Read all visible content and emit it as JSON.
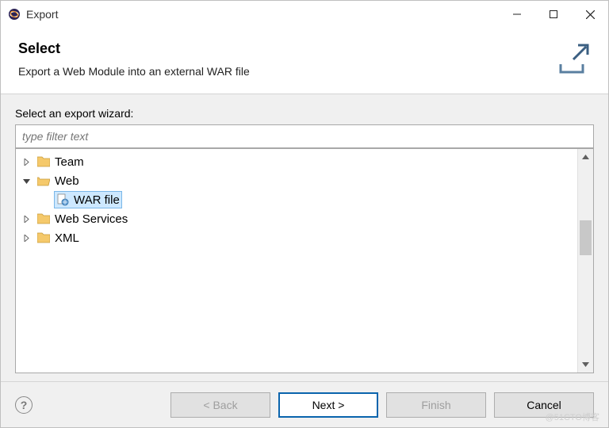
{
  "window": {
    "title": "Export"
  },
  "header": {
    "title": "Select",
    "description": "Export a Web Module into an external WAR file"
  },
  "main": {
    "wizard_label": "Select an export wizard:",
    "filter_placeholder": "type filter text",
    "tree": {
      "items": [
        {
          "label": "Team",
          "expanded": false,
          "depth": 1
        },
        {
          "label": "Web",
          "expanded": true,
          "depth": 1
        },
        {
          "label": "WAR file",
          "expanded": null,
          "depth": 2,
          "selected": true
        },
        {
          "label": "Web Services",
          "expanded": false,
          "depth": 1
        },
        {
          "label": "XML",
          "expanded": false,
          "depth": 1
        }
      ]
    }
  },
  "buttons": {
    "back": "< Back",
    "next": "Next >",
    "finish": "Finish",
    "cancel": "Cancel"
  },
  "watermark": "@51CTO博客"
}
